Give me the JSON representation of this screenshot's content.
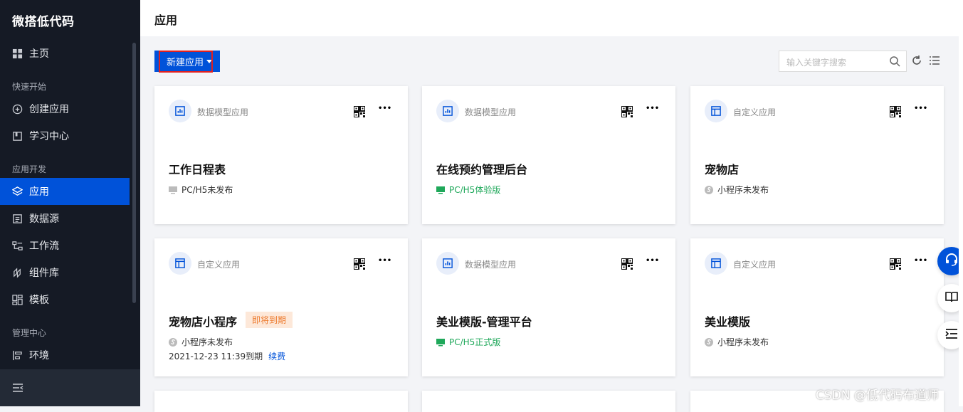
{
  "app": {
    "logo": "微搭低代码"
  },
  "sidebar": {
    "home": "主页",
    "group_quick": "快速开始",
    "create_app": "创建应用",
    "learn": "学习中心",
    "group_dev": "应用开发",
    "apps": "应用",
    "datasource": "数据源",
    "workflow": "工作流",
    "components": "组件库",
    "templates": "模板",
    "group_admin": "管理中心",
    "env": "环境"
  },
  "header": {
    "title": "应用"
  },
  "toolbar": {
    "new_app_label": "新建应用",
    "search_placeholder": "输入关键字搜索"
  },
  "cards": [
    {
      "type": "数据模型应用",
      "type_icon": "chart-icon",
      "name": "工作日程表",
      "status": "PC/H5未发布",
      "status_kind": "pc-gray"
    },
    {
      "type": "数据模型应用",
      "type_icon": "chart-icon",
      "name": "在线预约管理后台",
      "status": "PC/H5体验版",
      "status_kind": "pc-green"
    },
    {
      "type": "自定义应用",
      "type_icon": "layout-icon",
      "name": "宠物店",
      "status": "小程序未发布",
      "status_kind": "mp-gray"
    },
    {
      "type": "自定义应用",
      "type_icon": "layout-icon",
      "name": "宠物店小程序",
      "status": "小程序未发布",
      "status_kind": "mp-gray",
      "badge": "即将到期",
      "expire": "2021-12-23 11:39到期",
      "renew": "续费"
    },
    {
      "type": "数据模型应用",
      "type_icon": "chart-icon",
      "name": "美业模版-管理平台",
      "status": "PC/H5正式版",
      "status_kind": "pc-green"
    },
    {
      "type": "自定义应用",
      "type_icon": "layout-icon",
      "name": "美业模版",
      "status": "小程序未发布",
      "status_kind": "mp-gray"
    }
  ],
  "watermark": "CSDN @低代码布道师",
  "colors": {
    "accent": "#0052d9",
    "sidebar_bg": "#151a25",
    "green": "#1fa85a",
    "warn": "#ed7b2f"
  }
}
